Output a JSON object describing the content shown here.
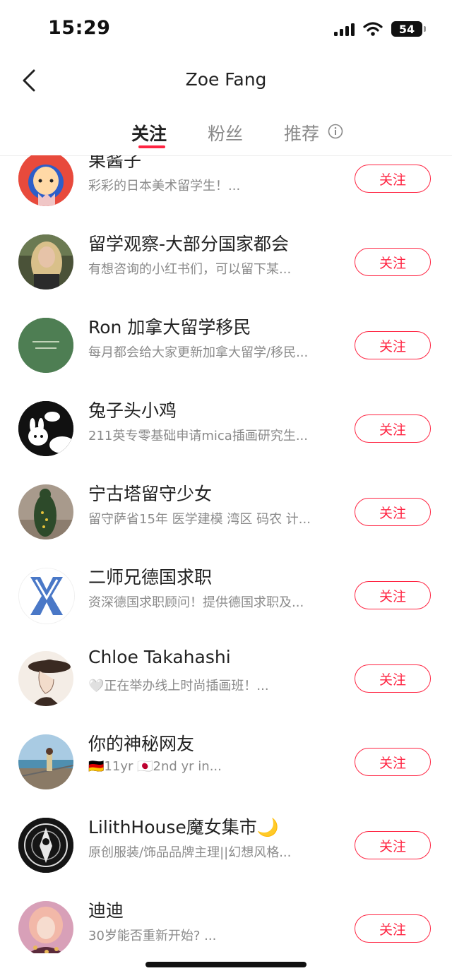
{
  "status_bar": {
    "time": "15:29",
    "battery": "54"
  },
  "header": {
    "title": "Zoe Fang"
  },
  "tabs": [
    {
      "label": "关注",
      "active": true
    },
    {
      "label": "粉丝",
      "active": false
    },
    {
      "label": "推荐",
      "active": false
    }
  ],
  "follow_label": "关注",
  "users": [
    {
      "name": "果酱子",
      "desc": "彩彩的日本美术留学生！..."
    },
    {
      "name": "留学观察-大部分国家都会",
      "desc": "有想咨询的小红书们，可以留下某..."
    },
    {
      "name": "Ron 加拿大留学移民",
      "desc": "每月都会给大家更新加拿大留学/移民..."
    },
    {
      "name": "兔子头小鸡",
      "desc": "211英专零基础申请mica插画研究生..."
    },
    {
      "name": "宁古塔留守少女",
      "desc": "留守萨省15年 医学建模  湾区 码农 计..."
    },
    {
      "name": "二师兄德国求职",
      "desc": "资深德国求职顾问！提供德国求职及..."
    },
    {
      "name": "Chloe Takahashi",
      "desc": "🤍正在举办线上时尚插画班！..."
    },
    {
      "name": "你的神秘网友",
      "desc": "🇩🇪11yr 🇯🇵2nd yr in..."
    },
    {
      "name": "LilithHouse魔女集市🌙",
      "desc": "原创服装/饰品品牌主理||幻想风格..."
    },
    {
      "name": "迪迪",
      "desc": "30岁能否重新开始? ..."
    }
  ],
  "colors": {
    "accent": "#ff2442",
    "text_primary": "#222222",
    "text_secondary": "#8a8a8a"
  }
}
